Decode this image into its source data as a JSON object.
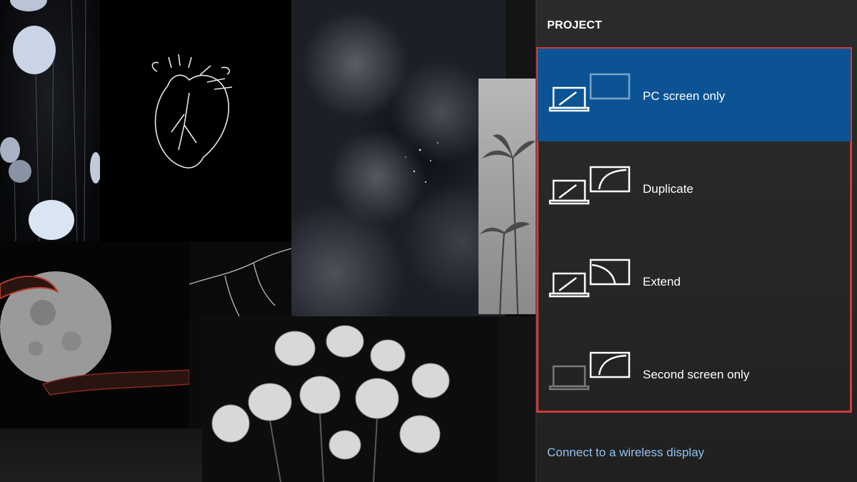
{
  "panel": {
    "title": "PROJECT",
    "options": [
      {
        "label": "PC screen only",
        "icon": "pc-screen-only-icon",
        "selected": true
      },
      {
        "label": "Duplicate",
        "icon": "duplicate-icon",
        "selected": false
      },
      {
        "label": "Extend",
        "icon": "extend-icon",
        "selected": false
      },
      {
        "label": "Second screen only",
        "icon": "second-screen-only-icon",
        "selected": false
      }
    ],
    "connect_link": "Connect to a wireless display"
  },
  "colors": {
    "selected_bg": "#0b5394",
    "highlight_outline": "#d23a3a",
    "link": "#8fc1ee",
    "panel_bg": "#2b2b2b"
  }
}
